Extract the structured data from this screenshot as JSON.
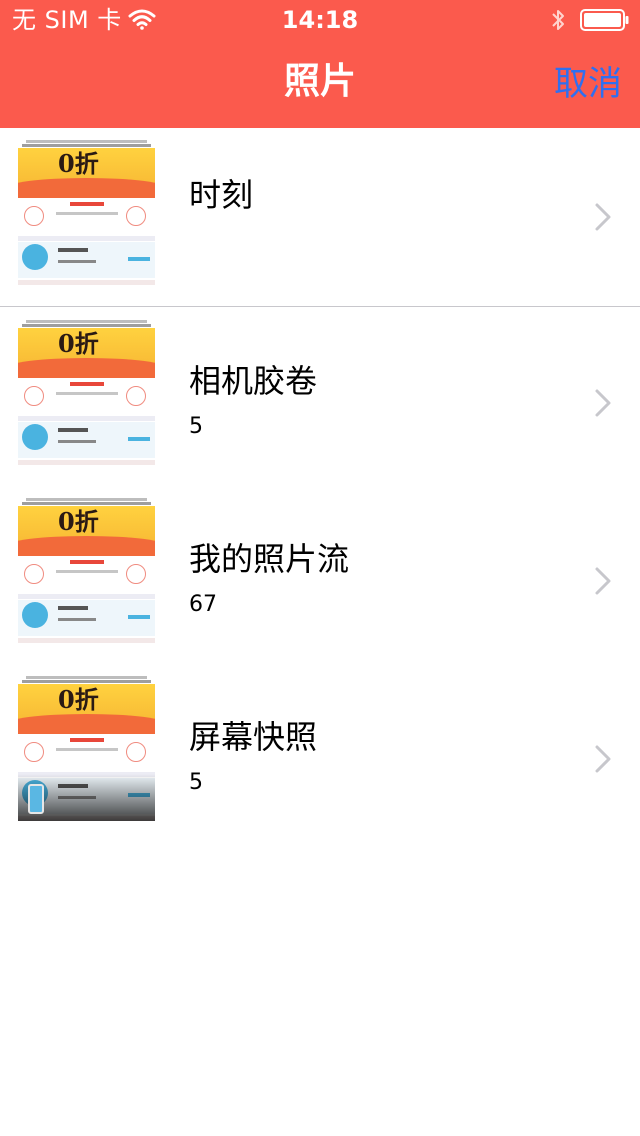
{
  "status_bar": {
    "carrier": "无 SIM 卡",
    "time": "14:18",
    "wifi_icon": "wifi-icon",
    "bluetooth_icon": "bluetooth-icon",
    "battery_icon": "battery-icon"
  },
  "nav": {
    "title": "照片",
    "cancel_label": "取消"
  },
  "colors": {
    "header_bg": "#fb5a4d",
    "cancel_text": "#2f6ff0",
    "chevron": "#c7c7cc"
  },
  "albums": [
    {
      "title": "时刻",
      "count": ""
    },
    {
      "title": "相机胶卷",
      "count": "5"
    },
    {
      "title": "我的照片流",
      "count": "67"
    },
    {
      "title": "屏幕快照",
      "count": "5"
    }
  ],
  "thumbnail": {
    "banner_text": "0折"
  }
}
